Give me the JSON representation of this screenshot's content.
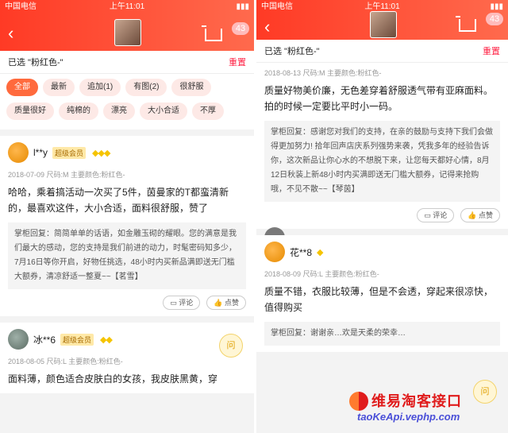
{
  "status": {
    "carrier": "中国电信",
    "time": "上午11:01"
  },
  "nav": {
    "badge": "43"
  },
  "selected": {
    "label": "已选 \"粉红色-\"",
    "reset": "重置"
  },
  "tags": [
    "全部",
    "最新",
    "追加(1)",
    "有图(2)",
    "很舒服",
    "质量很好",
    "纯棉的",
    "漂亮",
    "大小合适",
    "不厚"
  ],
  "left_reviews": [
    {
      "user": "l**y",
      "vip": "超级会员",
      "meta": "2018-07-09  尺码:M 主要颜色:粉红色-",
      "text": "哈哈，乘着搞活动一次买了5件，茵曼家的T都蛮清新的，最喜欢这件，大小合适，面料很舒服，赞了",
      "reply": "掌柜回复：简简单单的话语，如金雕玉砌的耀眼。您的满意是我们最大的感动，您的支持是我们前进的动力，时髦密码知多少，7月16日等你开启，好物任挑选，48小时内买新品满即送无门槛大额券，清凉舒适一整夏~~【茗雪】",
      "comment": "评论",
      "like": "点赞"
    },
    {
      "user": "冰**6",
      "vip": "超级会员",
      "meta": "2018-08-05  尺码:L 主要颜色:粉红色-",
      "text": "面料薄，颜色适合皮肤白的女孩，我皮肤黑黄，穿"
    }
  ],
  "right_reviews": [
    {
      "meta": "2018-08-13  尺码:M 主要颜色:粉红色-",
      "text": "质量好物美价廉，无色差穿着舒服透气带有亚麻面料。拍的时候一定要比平时小一码。",
      "reply": "掌柜回复：感谢您对我们的支持，在亲的鼓励与支持下我们会做得更加努力! 拾年回声店庆系列强势来袭，凭我多年的经验告诉你，这次新品让你心水的不想脱下来，让您每天都好心情，8月12日秋装上新48小时内买满即送无门槛大额券，记得来抢购哦，不见不散~~【琴茵】",
      "comment": "评论",
      "like": "点赞"
    },
    {
      "user": "花**8",
      "meta": "2018-08-09  尺码:L 主要颜色:粉红色-",
      "text": "质量不错，衣服比较薄，但是不会透，穿起来很凉快，值得购买",
      "reply": "掌柜回复：谢谢亲…欢是天柔的荣幸…"
    }
  ],
  "ask": "问",
  "watermark": {
    "title": "维易淘客接口",
    "url": "taoKeApi.vephp.com"
  }
}
